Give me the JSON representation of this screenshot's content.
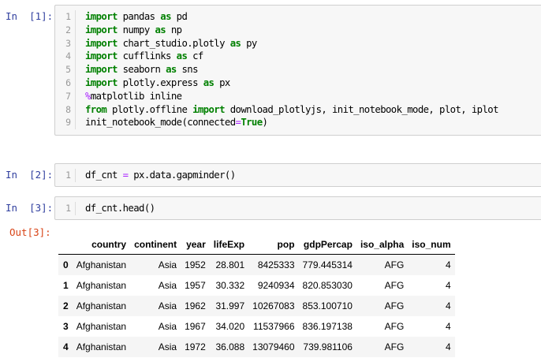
{
  "cells": [
    {
      "prompt": "In  [1]:",
      "lines": [
        {
          "num": "1",
          "tokens": [
            {
              "t": "import",
              "c": "kw"
            },
            {
              "t": " pandas ",
              "c": ""
            },
            {
              "t": "as",
              "c": "kw"
            },
            {
              "t": " pd",
              "c": ""
            }
          ]
        },
        {
          "num": "2",
          "tokens": [
            {
              "t": "import",
              "c": "kw"
            },
            {
              "t": " numpy ",
              "c": ""
            },
            {
              "t": "as",
              "c": "kw"
            },
            {
              "t": " np",
              "c": ""
            }
          ]
        },
        {
          "num": "3",
          "tokens": [
            {
              "t": "import",
              "c": "kw"
            },
            {
              "t": " chart_studio.plotly ",
              "c": ""
            },
            {
              "t": "as",
              "c": "kw"
            },
            {
              "t": " py",
              "c": ""
            }
          ]
        },
        {
          "num": "4",
          "tokens": [
            {
              "t": "import",
              "c": "kw"
            },
            {
              "t": " cufflinks ",
              "c": ""
            },
            {
              "t": "as",
              "c": "kw"
            },
            {
              "t": " cf",
              "c": ""
            }
          ]
        },
        {
          "num": "5",
          "tokens": [
            {
              "t": "import",
              "c": "kw"
            },
            {
              "t": " seaborn ",
              "c": ""
            },
            {
              "t": "as",
              "c": "kw"
            },
            {
              "t": " sns",
              "c": ""
            }
          ]
        },
        {
          "num": "6",
          "tokens": [
            {
              "t": "import",
              "c": "kw"
            },
            {
              "t": " plotly.express ",
              "c": ""
            },
            {
              "t": "as",
              "c": "kw"
            },
            {
              "t": " px",
              "c": ""
            }
          ]
        },
        {
          "num": "7",
          "tokens": [
            {
              "t": "%",
              "c": "mg"
            },
            {
              "t": "matplotlib inline",
              "c": ""
            }
          ]
        },
        {
          "num": "8",
          "tokens": [
            {
              "t": "from",
              "c": "kw"
            },
            {
              "t": " plotly.offline ",
              "c": ""
            },
            {
              "t": "import",
              "c": "kw"
            },
            {
              "t": " download_plotlyjs, init_notebook_mode, plot, iplot",
              "c": ""
            }
          ]
        },
        {
          "num": "9",
          "tokens": [
            {
              "t": "init_notebook_mode(connected",
              "c": ""
            },
            {
              "t": "=",
              "c": "eq"
            },
            {
              "t": "True",
              "c": "kw"
            },
            {
              "t": ")",
              "c": ""
            }
          ]
        }
      ]
    },
    {
      "prompt": "In  [2]:",
      "lines": [
        {
          "num": "1",
          "tokens": [
            {
              "t": "df_cnt ",
              "c": ""
            },
            {
              "t": "=",
              "c": "eq"
            },
            {
              "t": " px.data.gapminder()",
              "c": ""
            }
          ]
        }
      ]
    },
    {
      "prompt": "In  [3]:",
      "lines": [
        {
          "num": "1",
          "tokens": [
            {
              "t": "df_cnt.head()",
              "c": ""
            }
          ]
        }
      ]
    }
  ],
  "output": {
    "prompt": "Out[3]:",
    "columns": [
      "",
      "country",
      "continent",
      "year",
      "lifeExp",
      "pop",
      "gdpPercap",
      "iso_alpha",
      "iso_num"
    ],
    "rows": [
      [
        "0",
        "Afghanistan",
        "Asia",
        "1952",
        "28.801",
        "8425333",
        "779.445314",
        "AFG",
        "4"
      ],
      [
        "1",
        "Afghanistan",
        "Asia",
        "1957",
        "30.332",
        "9240934",
        "820.853030",
        "AFG",
        "4"
      ],
      [
        "2",
        "Afghanistan",
        "Asia",
        "1962",
        "31.997",
        "10267083",
        "853.100710",
        "AFG",
        "4"
      ],
      [
        "3",
        "Afghanistan",
        "Asia",
        "1967",
        "34.020",
        "11537966",
        "836.197138",
        "AFG",
        "4"
      ],
      [
        "4",
        "Afghanistan",
        "Asia",
        "1972",
        "36.088",
        "13079460",
        "739.981106",
        "AFG",
        "4"
      ]
    ]
  }
}
